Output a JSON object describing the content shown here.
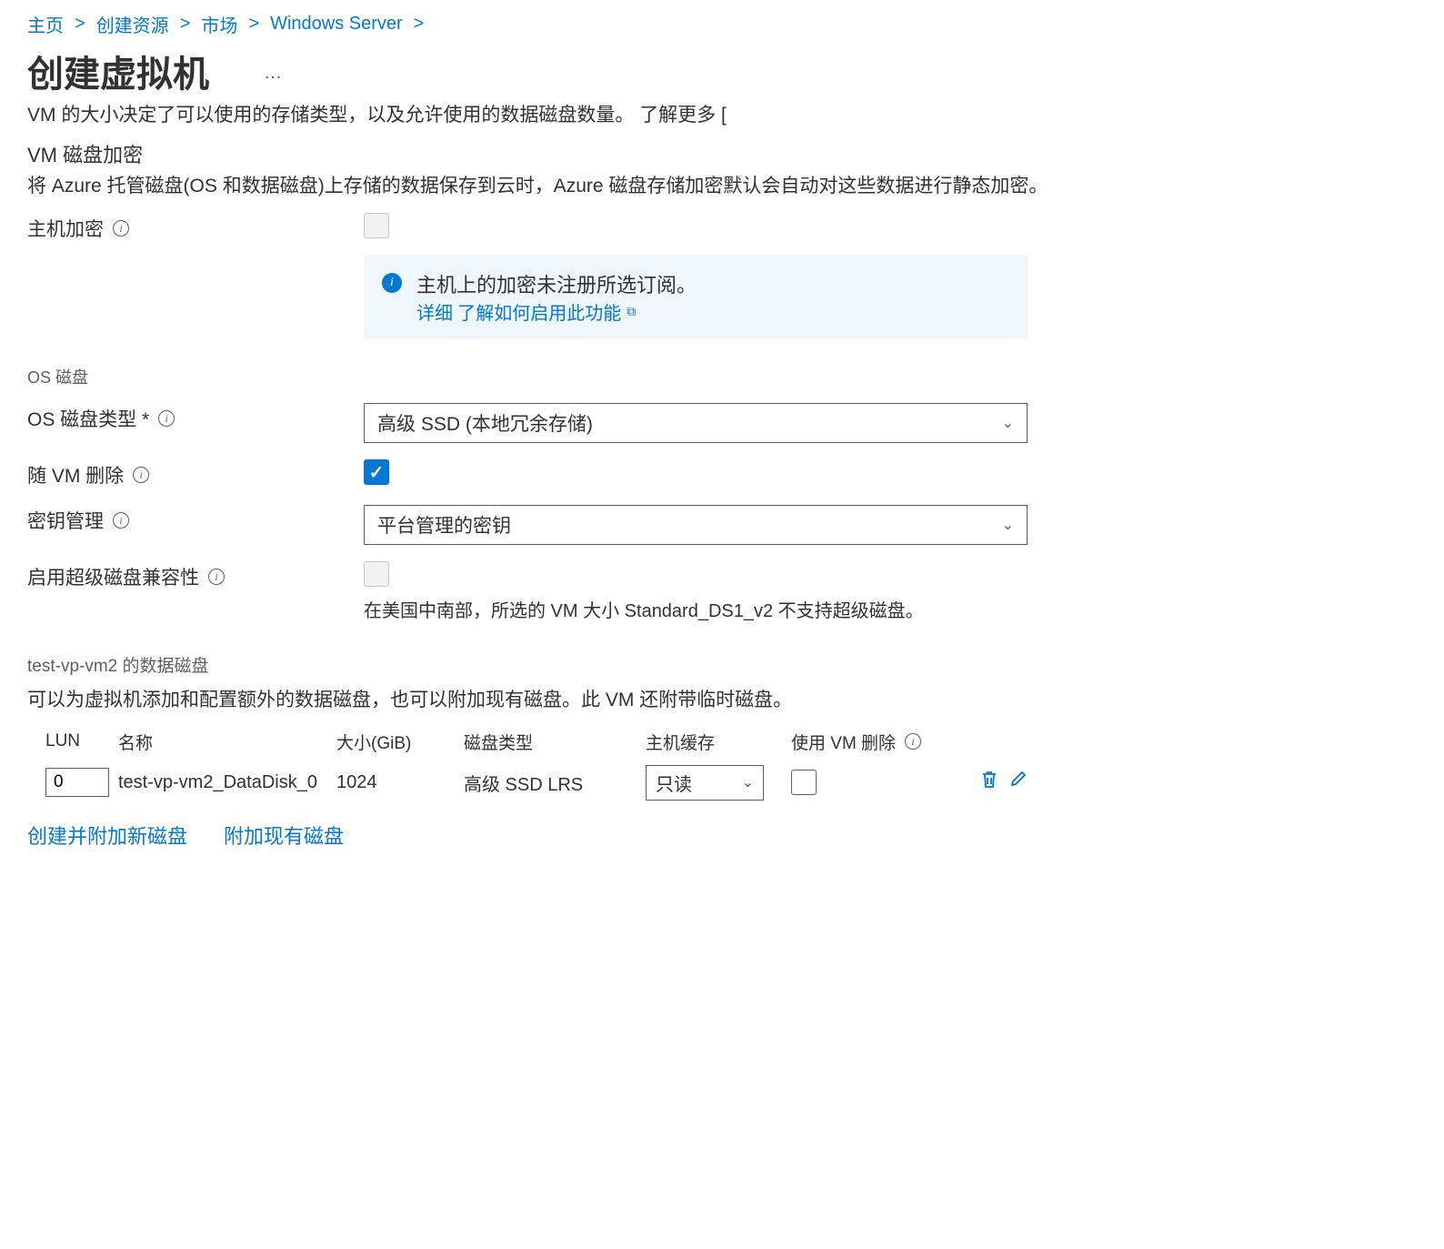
{
  "breadcrumb": {
    "home": "主页",
    "create_resource": "创建资源",
    "marketplace": "市场",
    "windows_server": "Windows Server"
  },
  "page": {
    "title": "创建虚拟机",
    "ellipsis": "…",
    "subtitle_prefix": "VM 的大小决定了可以使用的存储类型，以及允许使用的数据磁盘数量。",
    "learn_more": "了解更多"
  },
  "encryption": {
    "section_title": "VM 磁盘加密",
    "section_desc": "将 Azure 托管磁盘(OS 和数据磁盘)上存储的数据保存到云时，Azure 磁盘存储加密默认会自动对这些数据进行静态加密。",
    "host_encryption_label": "主机加密",
    "info_box_text": "主机上的加密未注册所选订阅。",
    "info_box_link_prefix": "详细",
    "info_box_link": "了解如何启用此功能"
  },
  "os_disk": {
    "section_label": "OS 磁盘",
    "type_label": "OS 磁盘类型 *",
    "type_value": "高级 SSD (本地冗余存储)",
    "delete_with_vm_label": "随 VM 删除",
    "key_mgmt_label": "密钥管理",
    "key_mgmt_value": "平台管理的密钥",
    "ultra_disk_label": "启用超级磁盘兼容性",
    "ultra_disk_hint": "在美国中南部，所选的 VM 大小 Standard_DS1_v2 不支持超级磁盘。"
  },
  "data_disks": {
    "section_label": "test-vp-vm2 的数据磁盘",
    "section_desc": "可以为虚拟机添加和配置额外的数据磁盘，也可以附加现有磁盘。此 VM 还附带临时磁盘。",
    "headers": {
      "lun": "LUN",
      "name": "名称",
      "size": "大小(GiB)",
      "type": "磁盘类型",
      "cache": "主机缓存",
      "delete": "使用 VM 删除"
    },
    "row": {
      "lun": "0",
      "name": "test-vp-vm2_DataDisk_0",
      "size": "1024",
      "type": "高级 SSD LRS",
      "cache": "只读"
    },
    "create_attach": "创建并附加新磁盘",
    "attach_existing": "附加现有磁盘"
  }
}
